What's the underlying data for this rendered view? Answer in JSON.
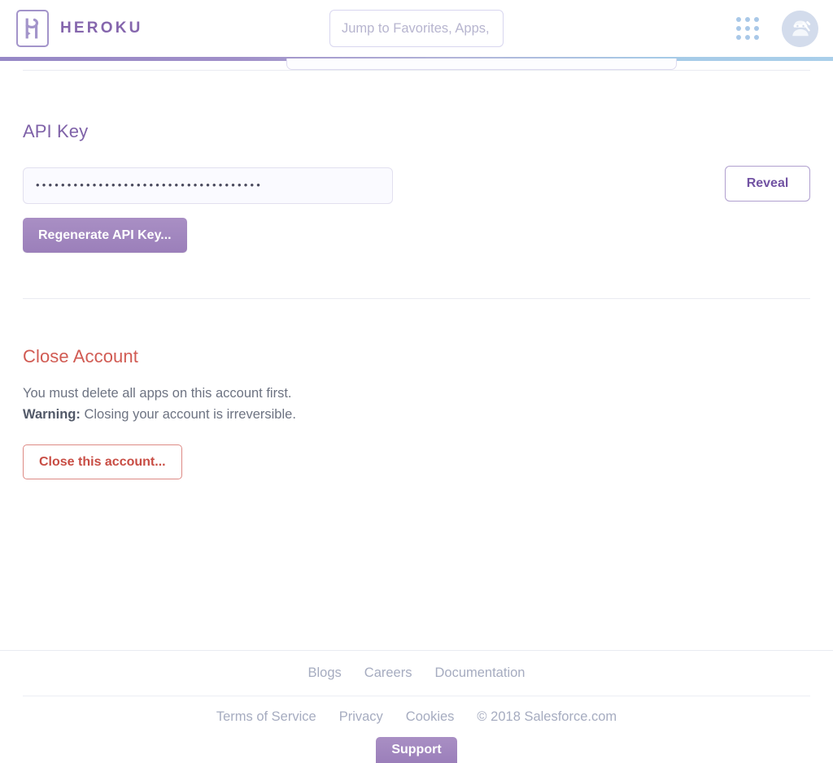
{
  "header": {
    "brand_name": "HEROKU",
    "logo_icon": "heroku-logo-icon",
    "search": {
      "placeholder": "Jump to Favorites, Apps, Pipelines, Spaces...",
      "value": ""
    },
    "app_launcher_icon": "app-grid-icon",
    "avatar_icon": "ninja-avatar-icon"
  },
  "api_key_section": {
    "title": "API Key",
    "masked_value": "••••••••••••••••••••••••••••••••••••",
    "reveal_label": "Reveal",
    "regenerate_label": "Regenerate API Key..."
  },
  "close_account_section": {
    "title": "Close Account",
    "line1": "You must delete all apps on this account first.",
    "warning_label": "Warning:",
    "warning_text": " Closing your account is irreversible.",
    "close_button_label": "Close this account..."
  },
  "footer": {
    "primary_links": [
      "Blogs",
      "Careers",
      "Documentation"
    ],
    "secondary_links": [
      "Terms of Service",
      "Privacy",
      "Cookies"
    ],
    "copyright": "© 2018 Salesforce.com",
    "support_label": "Support"
  },
  "colors": {
    "brand_purple": "#8566ad",
    "accent_purple": "#9b7fba",
    "danger_red": "#c84d44",
    "muted_text": "#a6acc0",
    "gradient_start": "#9688c6",
    "gradient_end": "#a9cfea"
  }
}
